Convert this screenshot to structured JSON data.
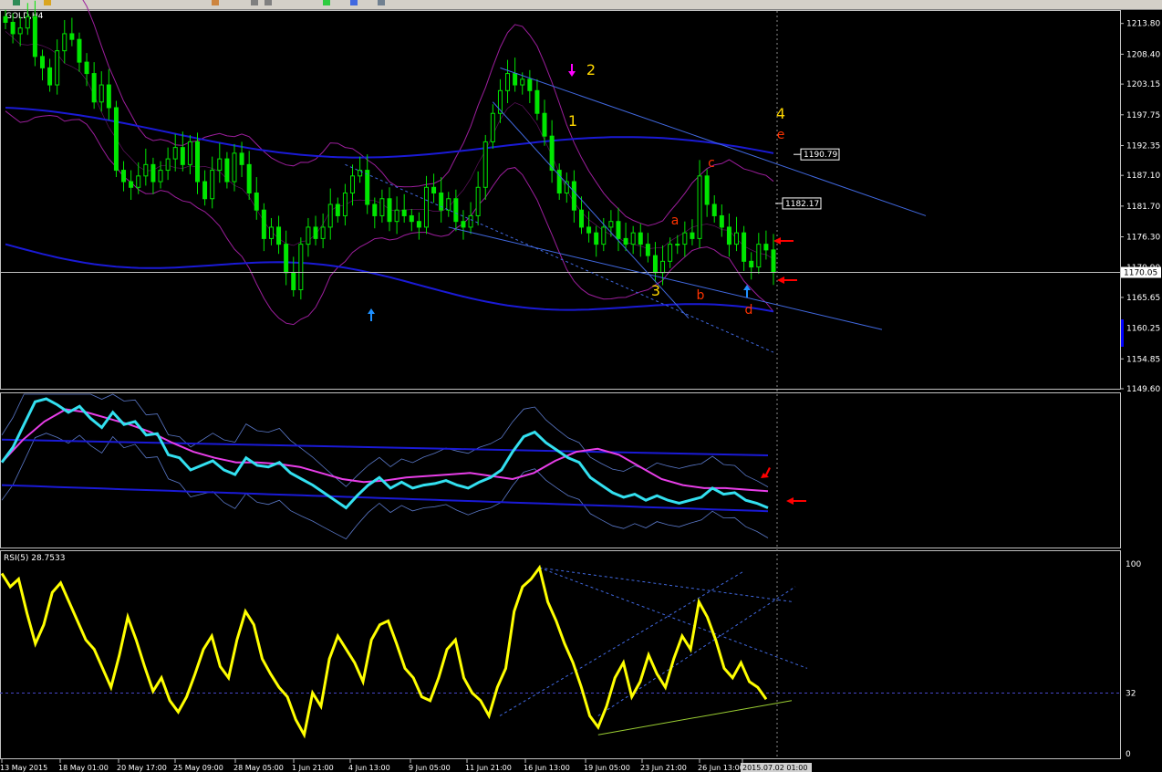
{
  "toolbar": {
    "icons": [
      "new-order-icon",
      "folder-icon",
      "pencil-icon",
      "tool-icon",
      "chart-icon",
      "plus-icon",
      "line-icon",
      "arrow-icon"
    ]
  },
  "symbol_label": "GOLD,H4",
  "rsi_label": "RSI(5) 28.7533",
  "colors": {
    "candle": "#00e600",
    "bollinger": "#9c1e9c",
    "slow_band": "#1a1ad6",
    "channel": "#4169e1",
    "cyan_line": "#33e0f0",
    "magenta_line": "#e83ee8",
    "rsi": "#ffff00",
    "wave_yellow": "#ffd700",
    "wave_red": "#ff3300",
    "arrow_red": "#ff0000",
    "arrow_blue": "#1e90ff",
    "arrow_magenta": "#ff00ff"
  },
  "chart_data": [
    {
      "type": "candlestick",
      "panel": "price",
      "symbol": "GOLD,H4",
      "ylim": [
        1149.6,
        1216.0
      ],
      "y_ticks": [
        "1213.80",
        "1208.40",
        "1203.15",
        "1197.75",
        "1192.35",
        "1187.10",
        "1181.70",
        "1176.30",
        "1170.90",
        "1165.65",
        "1160.25",
        "1154.85",
        "1149.60"
      ],
      "current_price": "1170.05",
      "price_boxes": [
        "1190.79",
        "1182.17"
      ],
      "close_path": [
        1214,
        1212,
        1213,
        1215,
        1208,
        1206,
        1203,
        1209,
        1212,
        1211,
        1207,
        1205,
        1200,
        1203,
        1199,
        1188,
        1186,
        1185,
        1187,
        1189,
        1186,
        1188,
        1190,
        1192,
        1189,
        1193,
        1186,
        1183,
        1188,
        1190,
        1186,
        1191,
        1189,
        1184,
        1181,
        1176,
        1178,
        1175,
        1170,
        1167,
        1175,
        1178,
        1176,
        1178,
        1182,
        1180,
        1184,
        1187,
        1188,
        1182,
        1180,
        1183,
        1179,
        1181,
        1180,
        1179,
        1178,
        1185,
        1184,
        1181,
        1183,
        1179,
        1178,
        1180,
        1185,
        1193,
        1198,
        1202,
        1205,
        1203,
        1204,
        1202,
        1198,
        1194,
        1188,
        1184,
        1186,
        1181,
        1178,
        1177,
        1175,
        1178,
        1179,
        1176,
        1175,
        1177,
        1175,
        1173,
        1170,
        1172,
        1175,
        1175,
        1177,
        1176,
        1187,
        1182,
        1180,
        1178,
        1175,
        1177,
        1172,
        1171,
        1175,
        1174,
        1170.05
      ],
      "wave_labels": [
        {
          "text": "1",
          "date": "17 Jun",
          "price": 1196
        },
        {
          "text": "2",
          "date": "18 Jun",
          "price": 1206
        },
        {
          "text": "3",
          "date": "22 Jun",
          "price": 1166
        },
        {
          "text": "4",
          "date": "2015.07.02",
          "price": 1199
        },
        {
          "text": "a",
          "date": "24 Jun",
          "price": 1180
        },
        {
          "text": "b",
          "date": "25 Jun",
          "price": 1166
        },
        {
          "text": "c",
          "date": "26 Jun",
          "price": 1188
        },
        {
          "text": "d",
          "date": "29 Jun",
          "price": 1164
        },
        {
          "text": "e",
          "date": "2015.07.02",
          "price": 1195
        }
      ]
    },
    {
      "type": "line",
      "panel": "indicator",
      "series": [
        {
          "values": [
            0.55,
            0.65,
            0.8,
            0.95,
            0.97,
            0.93,
            0.88,
            0.92,
            0.84,
            0.78,
            0.88,
            0.8,
            0.82,
            0.73,
            0.74,
            0.6,
            0.58,
            0.5,
            0.53,
            0.56,
            0.5,
            0.47,
            0.58,
            0.53,
            0.52,
            0.55,
            0.48,
            0.44,
            0.4,
            0.35,
            0.3,
            0.25,
            0.33,
            0.4,
            0.45,
            0.38,
            0.42,
            0.38,
            0.4,
            0.41,
            0.43,
            0.4,
            0.38,
            0.42,
            0.45,
            0.5,
            0.62,
            0.72,
            0.75,
            0.68,
            0.63,
            0.58,
            0.55,
            0.45,
            0.4,
            0.35,
            0.32,
            0.34,
            0.3,
            0.33,
            0.3,
            0.28,
            0.3,
            0.32,
            0.38,
            0.34,
            0.35,
            0.3,
            0.28,
            0.25
          ]
        },
        {
          "values": [
            0.55,
            0.7,
            0.82,
            0.9,
            0.88,
            0.84,
            0.8,
            0.75,
            0.68,
            0.62,
            0.58,
            0.55,
            0.55,
            0.54,
            0.52,
            0.48,
            0.44,
            0.42,
            0.43,
            0.45,
            0.46,
            0.47,
            0.48,
            0.46,
            0.44,
            0.48,
            0.56,
            0.62,
            0.64,
            0.6,
            0.52,
            0.44,
            0.4,
            0.38,
            0.38,
            0.37,
            0.36
          ]
        }
      ],
      "annotations": [
        "red-arrow-down",
        "red-arrow-left"
      ]
    },
    {
      "type": "line",
      "panel": "rsi",
      "series": [
        {
          "name": "RSI(5) 28.7533",
          "values": [
            95,
            88,
            92,
            74,
            58,
            68,
            85,
            90,
            80,
            70,
            60,
            55,
            45,
            35,
            52,
            72,
            60,
            46,
            33,
            40,
            28,
            22,
            30,
            42,
            55,
            62,
            46,
            40,
            60,
            75,
            68,
            50,
            42,
            35,
            30,
            18,
            10,
            32,
            25,
            50,
            62,
            55,
            48,
            38,
            60,
            68,
            70,
            58,
            45,
            40,
            30,
            28,
            40,
            55,
            60,
            40,
            32,
            28,
            20,
            35,
            45,
            75,
            88,
            92,
            98,
            80,
            70,
            58,
            48,
            35,
            20,
            14,
            25,
            40,
            48,
            30,
            38,
            52,
            42,
            35,
            50,
            62,
            55,
            80,
            72,
            60,
            45,
            40,
            48,
            38,
            35,
            28.7533
          ]
        }
      ],
      "y_ticks": [
        "100",
        "32",
        "0"
      ],
      "level": 32
    }
  ],
  "x_axis_labels": [
    "13 May 2015",
    "18 May 01:00",
    "20 May 17:00",
    "25 May 09:00",
    "28 May 05:00",
    "1 Jun 21:00",
    "4 Jun 13:00",
    "9 Jun 05:00",
    "11 Jun 21:00",
    "16 Jun 13:00",
    "19 Jun 05:00",
    "23 Jun 21:00",
    "26 Jun 13:00",
    "2015.07.02 01:00"
  ]
}
